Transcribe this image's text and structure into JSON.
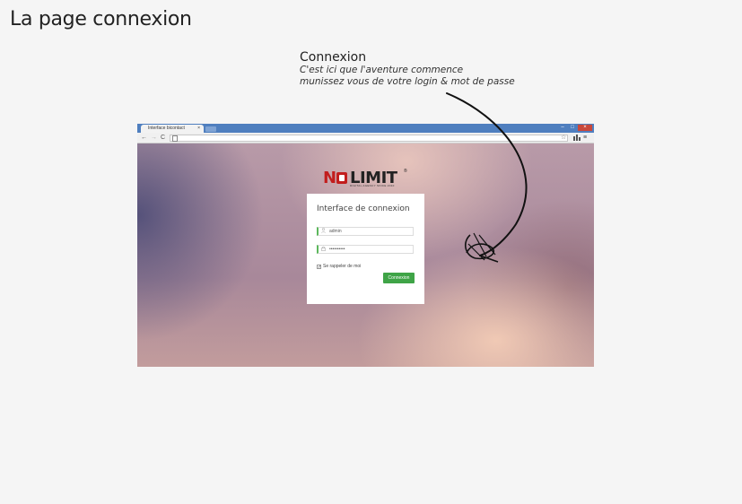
{
  "page_title": "La page connexion",
  "annotation": {
    "title": "Connexion",
    "line1": "C'est ici que l'aventure commence",
    "line2": "munissez vous de votre login & mot de passe"
  },
  "browser": {
    "tab_title": "Interface bicontact",
    "tab_close": "×",
    "nav_back": "←",
    "nav_forward": "→",
    "nav_reload": "C",
    "win_min": "–",
    "win_max": "□",
    "win_close": "×",
    "star": "☆",
    "menu": "≡"
  },
  "logo": {
    "no": "N",
    "limit": "LIMIT",
    "registered": "®",
    "tagline": "DIGITAL AGENCY SINCE 2010"
  },
  "login": {
    "title": "Interface de connexion",
    "username_value": "admin",
    "password_value": "••••••••••",
    "remember_label": "Se rappeler de moi",
    "remember_checked": true,
    "submit_label": "Connexion"
  },
  "colors": {
    "accent_green": "#3fa447",
    "brand_red": "#c21d1d",
    "chrome_blue": "#4f7fbf"
  }
}
